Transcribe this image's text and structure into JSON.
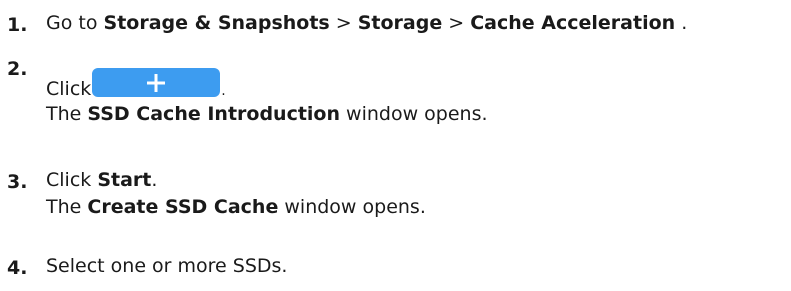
{
  "steps": [
    {
      "number": "1.",
      "prefix": "Go to ",
      "path1": "Storage & Snapshots",
      "sep1": " > ",
      "path2": "Storage",
      "sep2": " > ",
      "path3": "Cache Acceleration",
      "suffix": " ."
    },
    {
      "number": "2.",
      "prefix": "Click",
      "suffix": ".",
      "button_icon": "plus-icon",
      "result_prefix": "The ",
      "result_bold": "SSD Cache Introduction",
      "result_suffix": " window opens."
    },
    {
      "number": "3.",
      "prefix": "Click ",
      "bold": "Start",
      "suffix": ".",
      "result_prefix": "The ",
      "result_bold": "Create SSD Cache",
      "result_suffix": " window opens."
    },
    {
      "number": "4.",
      "text": "Select one or more SSDs."
    }
  ],
  "colors": {
    "button_bg": "#3d9cf0",
    "text": "#1a1a1a"
  }
}
